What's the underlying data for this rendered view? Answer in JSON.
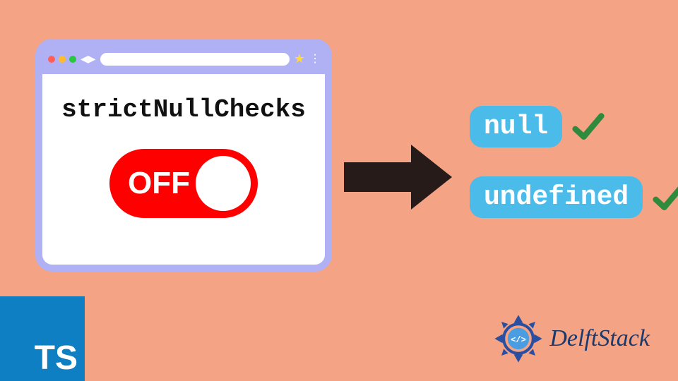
{
  "browser": {
    "code_label": "strictNullChecks",
    "toggle_state": "OFF"
  },
  "outputs": {
    "null_label": "null",
    "undefined_label": "undefined"
  },
  "ts_logo": "TS",
  "brand": "DelftStack",
  "colors": {
    "background": "#f5a385",
    "browser_border": "#b0b0f5",
    "toggle": "#ff0000",
    "badge": "#4bbbea",
    "ts_logo": "#0d7fc2",
    "check": "#2e8b3d"
  }
}
